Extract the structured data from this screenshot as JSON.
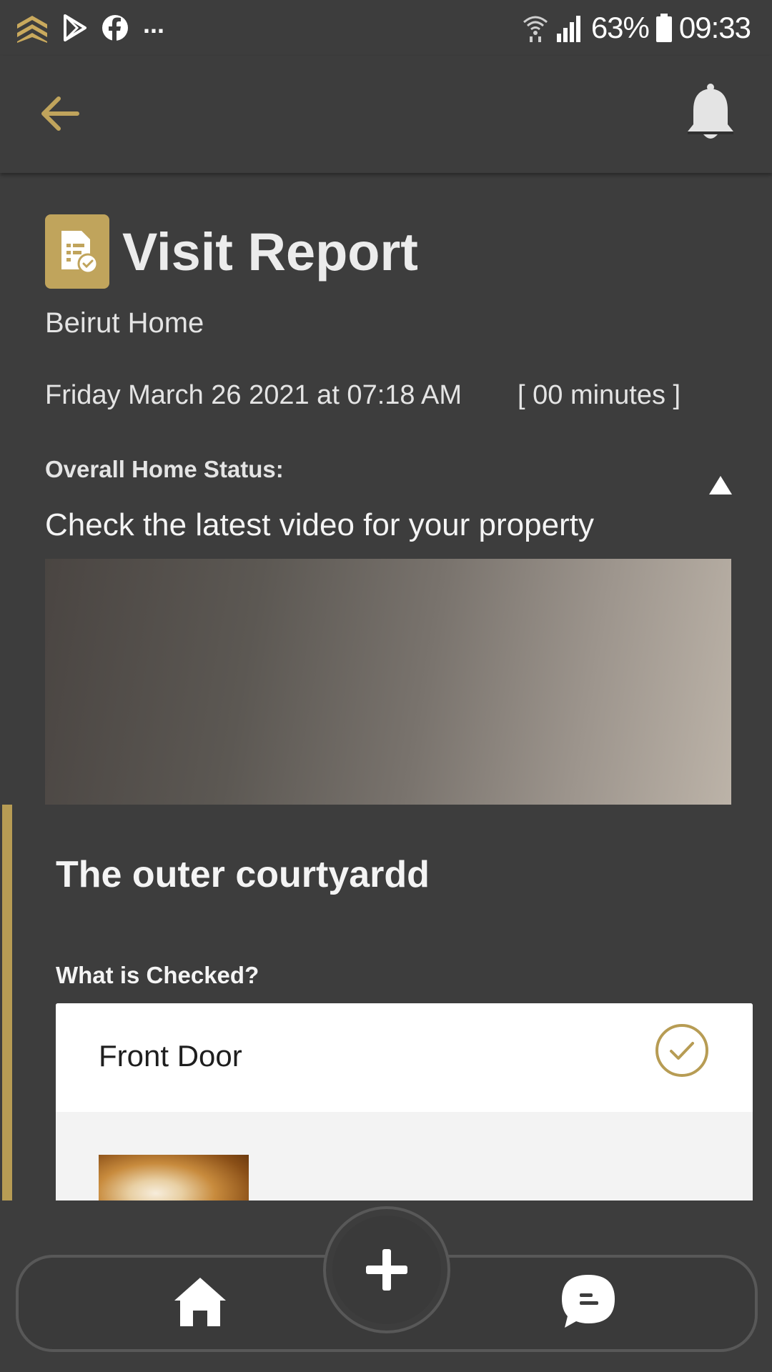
{
  "status_bar": {
    "battery": "63%",
    "time": "09:33",
    "more_indicator": "...",
    "icons": [
      "app-logo-icon",
      "play-store-icon",
      "facebook-icon",
      "wifi-icon",
      "signal-icon",
      "battery-icon"
    ]
  },
  "app_bar": {
    "back_icon": "arrow-left-icon",
    "notification_icon": "bell-icon"
  },
  "report": {
    "title": "Visit Report",
    "title_icon": "report-document-icon",
    "location": "Beirut Home",
    "datetime": "Friday March 26 2021 at 07:18 AM",
    "duration": "[ 00 minutes ]",
    "overall_status_label": "Overall Home Status:",
    "video_caption": "Check the latest video for your property"
  },
  "section": {
    "title": "The outer courtyardd",
    "checked_label": "What is Checked?",
    "items": [
      {
        "name": "Front Door",
        "checked": true
      }
    ]
  },
  "bottom_nav": {
    "items": [
      "home-icon",
      "plus-icon",
      "chat-icon"
    ]
  },
  "colors": {
    "background": "#3d3d3d",
    "accent": "#c0a45c",
    "text": "#ececec",
    "card": "#ffffff"
  }
}
